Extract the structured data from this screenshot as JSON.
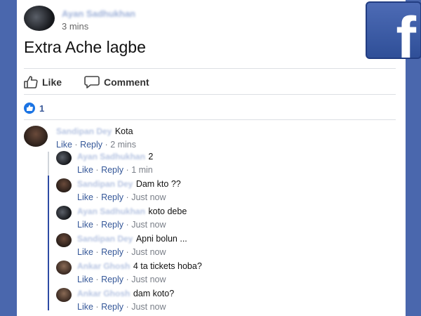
{
  "post": {
    "author": "Ayan Sadhukhan",
    "time": "3 mins",
    "text": "Extra Ache lagbe"
  },
  "actions": {
    "like": "Like",
    "comment": "Comment"
  },
  "reactions": {
    "count": "1"
  },
  "logo": {
    "letter": "f",
    "color": "#3b5998"
  },
  "comments": [
    {
      "author": "Sandipan Dey",
      "text": "Kota",
      "like": "Like",
      "reply": "Reply",
      "time": "2 mins"
    }
  ],
  "replies": [
    {
      "author": "Ayan Sadhukhan",
      "text": "2",
      "like": "Like",
      "reply": "Reply",
      "time": "1 min"
    },
    {
      "author": "Sandipan Dey",
      "text": "Dam kto ??",
      "like": "Like",
      "reply": "Reply",
      "time": "Just now"
    },
    {
      "author": "Ayan Sadhukhan",
      "text": "koto debe",
      "like": "Like",
      "reply": "Reply",
      "time": "Just now"
    },
    {
      "author": "Sandipan Dey",
      "text": "Apni bolun ...",
      "like": "Like",
      "reply": "Reply",
      "time": "Just now"
    },
    {
      "author": "Ankar Ghosh",
      "text": "4 ta tickets hoba?",
      "like": "Like",
      "reply": "Reply",
      "time": "Just now"
    },
    {
      "author": "Ankar Ghosh",
      "text": "dam koto?",
      "like": "Like",
      "reply": "Reply",
      "time": "Just now"
    }
  ]
}
